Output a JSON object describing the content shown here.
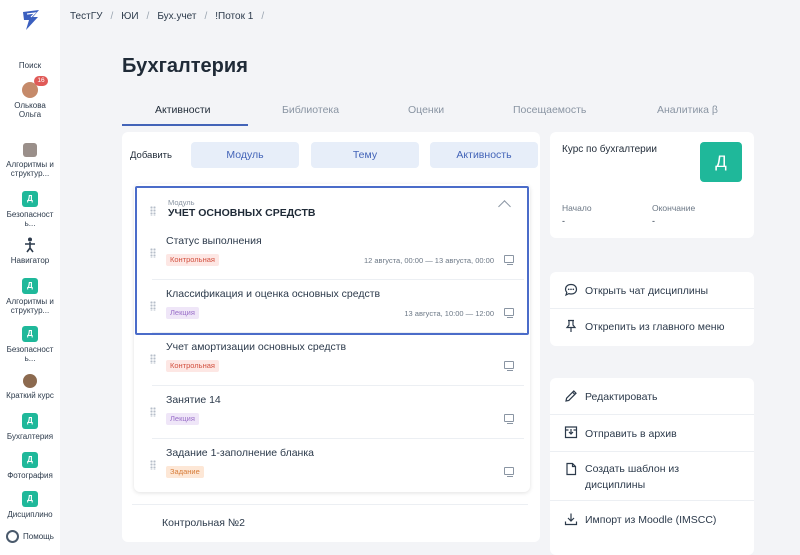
{
  "breadcrumb": [
    "ТестГУ",
    "ЮИ",
    "Бух.учет",
    "!Поток 1"
  ],
  "sidebar": {
    "search": "Поиск",
    "user": {
      "name_line1": "Олькова",
      "name_line2": "Ольга",
      "badge": "16"
    },
    "items": [
      {
        "icon": "course-image",
        "line1": "Алгоритмы и",
        "line2": "структур..."
      },
      {
        "icon": "Д",
        "line1": "Безопасност",
        "line2": "ь..."
      },
      {
        "icon": "navigator-figure",
        "line1": "Навигатор",
        "line2": ""
      },
      {
        "icon": "Д",
        "line1": "Алгоритмы и",
        "line2": "структур..."
      },
      {
        "icon": "Д",
        "line1": "Безопасност",
        "line2": "ь..."
      },
      {
        "icon": "course-image",
        "line1": "Краткий курс",
        "line2": ""
      },
      {
        "icon": "Д",
        "line1": "Бухгалтерия",
        "line2": ""
      },
      {
        "icon": "Д",
        "line1": "Фотография",
        "line2": ""
      },
      {
        "icon": "Д",
        "line1": "Дисциплино",
        "line2": ""
      }
    ],
    "help": "Помощь"
  },
  "page_title": "Бухгалтерия",
  "tabs": [
    "Активности",
    "Библиотека",
    "Оценки",
    "Посещаемость",
    "Аналитика β"
  ],
  "add": {
    "label": "Добавить",
    "buttons": [
      "Модуль",
      "Тему",
      "Активность"
    ]
  },
  "module": {
    "caption": "Модуль",
    "title": "УЧЕТ ОСНОВНЫХ СРЕДСТВ",
    "activities": [
      {
        "title": "Статус выполнения",
        "badge": "Контрольная",
        "badge_type": "control",
        "date": "12 августа, 00:00 — 13 августа, 00:00",
        "icon": "monitor-user-icon"
      },
      {
        "title": "Классификация и оценка основных средств",
        "badge": "Лекция",
        "badge_type": "lecture",
        "date": "13 августа, 10:00 — 12:00",
        "icon": "laptop-icon"
      },
      {
        "title": "Учет амортизации основных средств",
        "badge": "Контрольная",
        "badge_type": "control",
        "date": "",
        "icon": "monitor-user-icon"
      },
      {
        "title": "Занятие 14",
        "badge": "Лекция",
        "badge_type": "lecture",
        "date": "",
        "icon": "monitor-user-icon"
      },
      {
        "title": "Задание 1-заполнение бланка",
        "badge": "Задание",
        "badge_type": "task",
        "date": "",
        "icon": "monitor-user-icon"
      }
    ]
  },
  "next_module": {
    "title": "Контрольная №2"
  },
  "course": {
    "name": "Курс по бухгалтерии",
    "initial": "Д",
    "start_label": "Начало",
    "start_value": "-",
    "end_label": "Окончание",
    "end_value": "-"
  },
  "actions_group1": [
    "Открыть чат дисциплины",
    "Открепить из главного меню"
  ],
  "actions_group2": [
    "Редактировать",
    "Отправить в архив",
    [
      "Создать шаблон из",
      "дисциплины"
    ],
    "Импорт из Moodle (IMSCC)"
  ],
  "colors": {
    "accent": "#4364b8",
    "green": "#1fb89a",
    "highlight": "#4b6cc9"
  }
}
